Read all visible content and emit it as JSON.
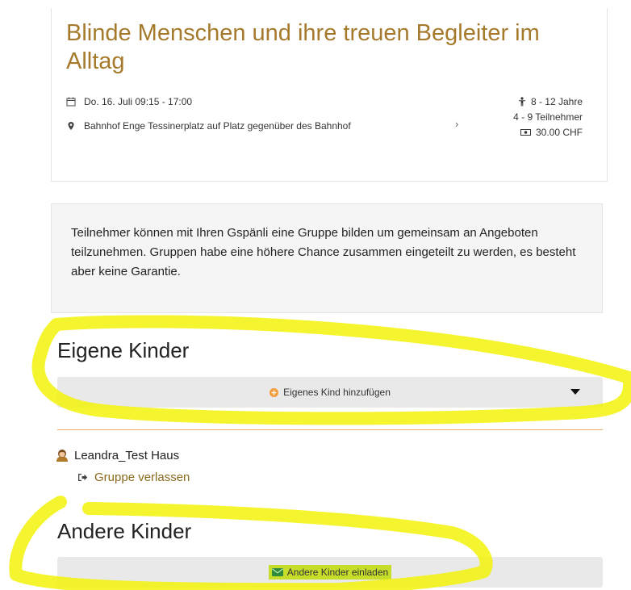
{
  "event": {
    "title": "Blinde Menschen und ihre treuen Begleiter im Alltag",
    "date_time": "Do. 16. Juli 09:15 - 17:00",
    "location": "Bahnhof Enge Tessinerplatz auf Platz gegenüber des Bahnhof",
    "age_range": "8 - 12 Jahre",
    "participants": "4 - 9 Teilnehmer",
    "price": "30.00 CHF"
  },
  "info": {
    "text": "Teilnehmer können mit Ihren Gspänli eine Gruppe bilden um gemeinsam an Angeboten teilzunehmen. Gruppen habe eine höhere Chance zusammen eingeteilt zu werden, es besteht aber keine Garantie."
  },
  "own_children": {
    "heading": "Eigene Kinder",
    "add_label": "Eigenes Kind hinzufügen"
  },
  "group": {
    "member_name": "Leandra_Test Haus",
    "leave_label": "Gruppe verlassen"
  },
  "other_children": {
    "heading": "Andere Kinder",
    "invite_label": "Andere Kinder einladen"
  },
  "colors": {
    "accent": "#a67a2c",
    "link": "#8a6a1e",
    "divider": "#f0a866",
    "highlight": "#f2f20a",
    "add_icon": "#f39c3a",
    "mail_icon": "#2e8b3a"
  },
  "icons": {
    "calendar": "calendar-icon",
    "location": "map-marker-icon",
    "chevron": "chevron-right-icon",
    "age": "child-icon",
    "price": "money-icon",
    "add": "plus-circle-icon",
    "caret": "caret-down-icon",
    "avatar": "avatar-icon",
    "leave": "sign-out-icon",
    "mail": "envelope-icon"
  }
}
